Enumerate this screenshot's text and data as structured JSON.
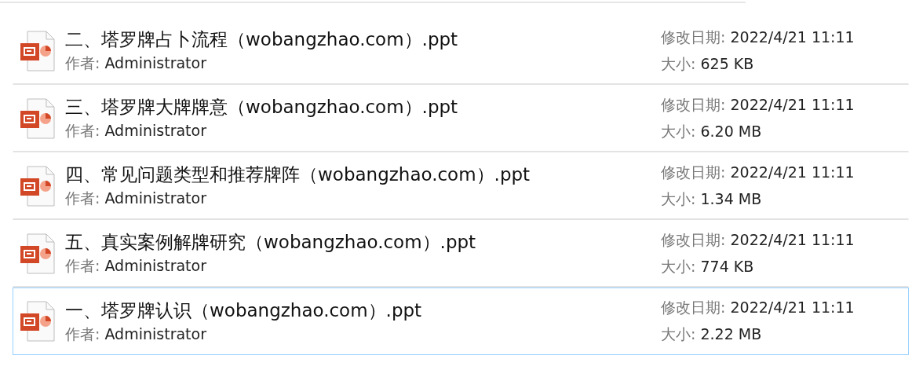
{
  "files": [
    {
      "name": "二、塔罗牌占卜流程（wobangzhao.com）.ppt",
      "author_label": "作者:",
      "author": "Administrator",
      "modified_label": "修改日期:",
      "modified": "2022/4/21 11:11",
      "size_label": "大小:",
      "size": "625 KB",
      "selected": false
    },
    {
      "name": "三、塔罗牌大牌牌意（wobangzhao.com）.ppt",
      "author_label": "作者:",
      "author": "Administrator",
      "modified_label": "修改日期:",
      "modified": "2022/4/21 11:11",
      "size_label": "大小:",
      "size": "6.20 MB",
      "selected": false
    },
    {
      "name": "四、常见问题类型和推荐牌阵（wobangzhao.com）.ppt",
      "author_label": "作者:",
      "author": "Administrator",
      "modified_label": "修改日期:",
      "modified": "2022/4/21 11:11",
      "size_label": "大小:",
      "size": "1.34 MB",
      "selected": false
    },
    {
      "name": "五、真实案例解牌研究（wobangzhao.com）.ppt",
      "author_label": "作者:",
      "author": "Administrator",
      "modified_label": "修改日期:",
      "modified": "2022/4/21 11:11",
      "size_label": "大小:",
      "size": "774 KB",
      "selected": false
    },
    {
      "name": "一、塔罗牌认识（wobangzhao.com）.ppt",
      "author_label": "作者:",
      "author": "Administrator",
      "modified_label": "修改日期:",
      "modified": "2022/4/21 11:11",
      "size_label": "大小:",
      "size": "2.22 MB",
      "selected": true
    }
  ]
}
